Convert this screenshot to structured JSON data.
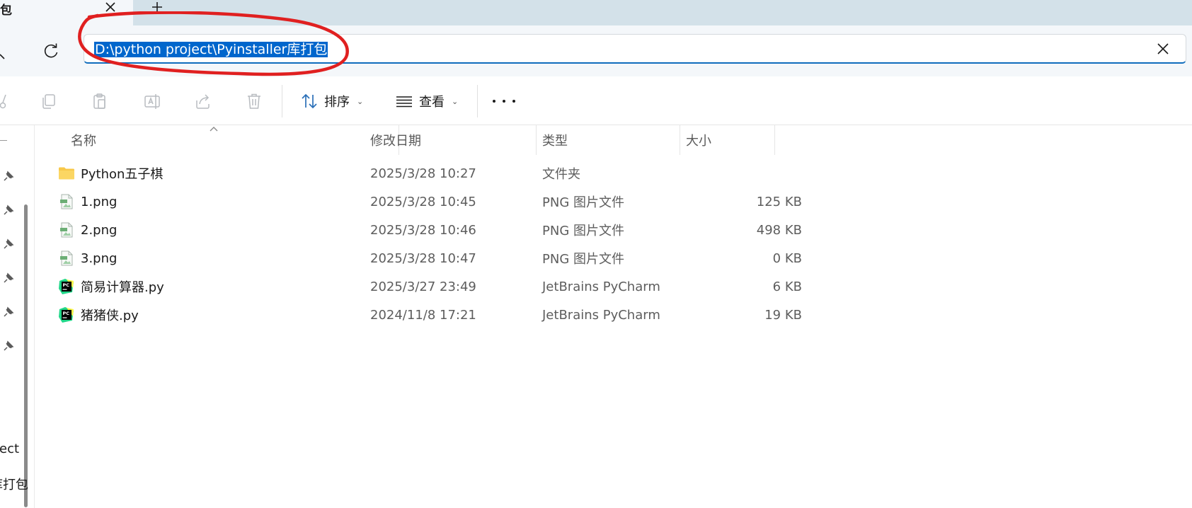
{
  "tab": {
    "title": "包",
    "new_tab_label": "+"
  },
  "address": {
    "path": "D:\\python project\\Pyinstaller库打包"
  },
  "toolbar": {
    "sort_label": "排序",
    "view_label": "查看"
  },
  "nav_pane": {
    "partial_labels": [
      "ect",
      "库打包"
    ]
  },
  "columns": {
    "name": "名称",
    "modified": "修改日期",
    "type": "类型",
    "size": "大小"
  },
  "files": [
    {
      "name": "Python五子棋",
      "modified": "2025/3/28 10:27",
      "type": "文件夹",
      "size": "",
      "icon": "folder-icon"
    },
    {
      "name": "1.png",
      "modified": "2025/3/28 10:45",
      "type": "PNG 图片文件",
      "size": "125 KB",
      "icon": "png-file-icon"
    },
    {
      "name": "2.png",
      "modified": "2025/3/28 10:46",
      "type": "PNG 图片文件",
      "size": "498 KB",
      "icon": "png-file-icon"
    },
    {
      "name": "3.png",
      "modified": "2025/3/28 10:47",
      "type": "PNG 图片文件",
      "size": "0 KB",
      "icon": "png-file-icon"
    },
    {
      "name": "简易计算器.py",
      "modified": "2025/3/27 23:49",
      "type": "JetBrains PyCharm",
      "size": "6 KB",
      "icon": "pycharm-file-icon"
    },
    {
      "name": "猪猪侠.py",
      "modified": "2024/11/8 17:21",
      "type": "JetBrains PyCharm",
      "size": "19 KB",
      "icon": "pycharm-file-icon"
    }
  ],
  "colors": {
    "accent": "#0f6cbd",
    "selection": "#0066cc",
    "annotation": "#e02020",
    "folder": "#f8c84a",
    "tabstrip": "#d3e1e9"
  }
}
